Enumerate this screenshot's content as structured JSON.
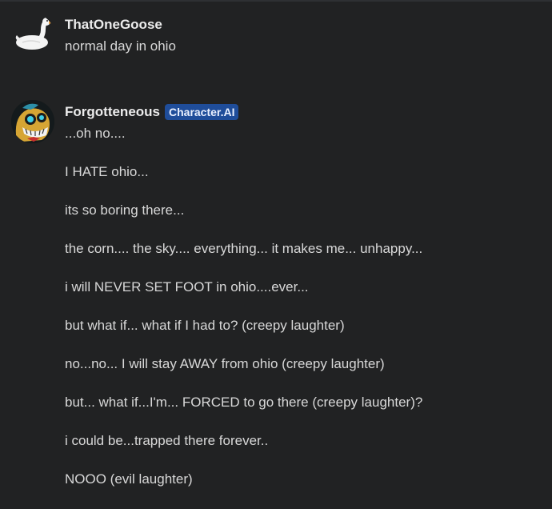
{
  "messages": [
    {
      "username": "ThatOneGoose",
      "avatar_icon": "goose-icon",
      "lines": [
        "normal day in ohio"
      ]
    },
    {
      "username": "Forgotteneous",
      "badge": "Character.AI",
      "avatar_icon": "animatronic-bird-icon",
      "lines": [
        "...oh no....",
        "I HATE ohio...",
        "its so boring there...",
        "the corn.... the sky.... everything... it makes me... unhappy...",
        "i will NEVER SET FOOT in ohio....ever...",
        "but what if... what if I had to? (creepy laughter)",
        "no...no... I will stay AWAY from ohio (creepy laughter)",
        "but... what if...I'm... FORCED to go there (creepy laughter)?",
        "i could be...trapped there forever..",
        "NOOO (evil laughter)"
      ]
    }
  ],
  "colors": {
    "background": "#212223",
    "badge": "#1f4d9a",
    "username": "#ececec",
    "text": "#d8d8d8"
  }
}
